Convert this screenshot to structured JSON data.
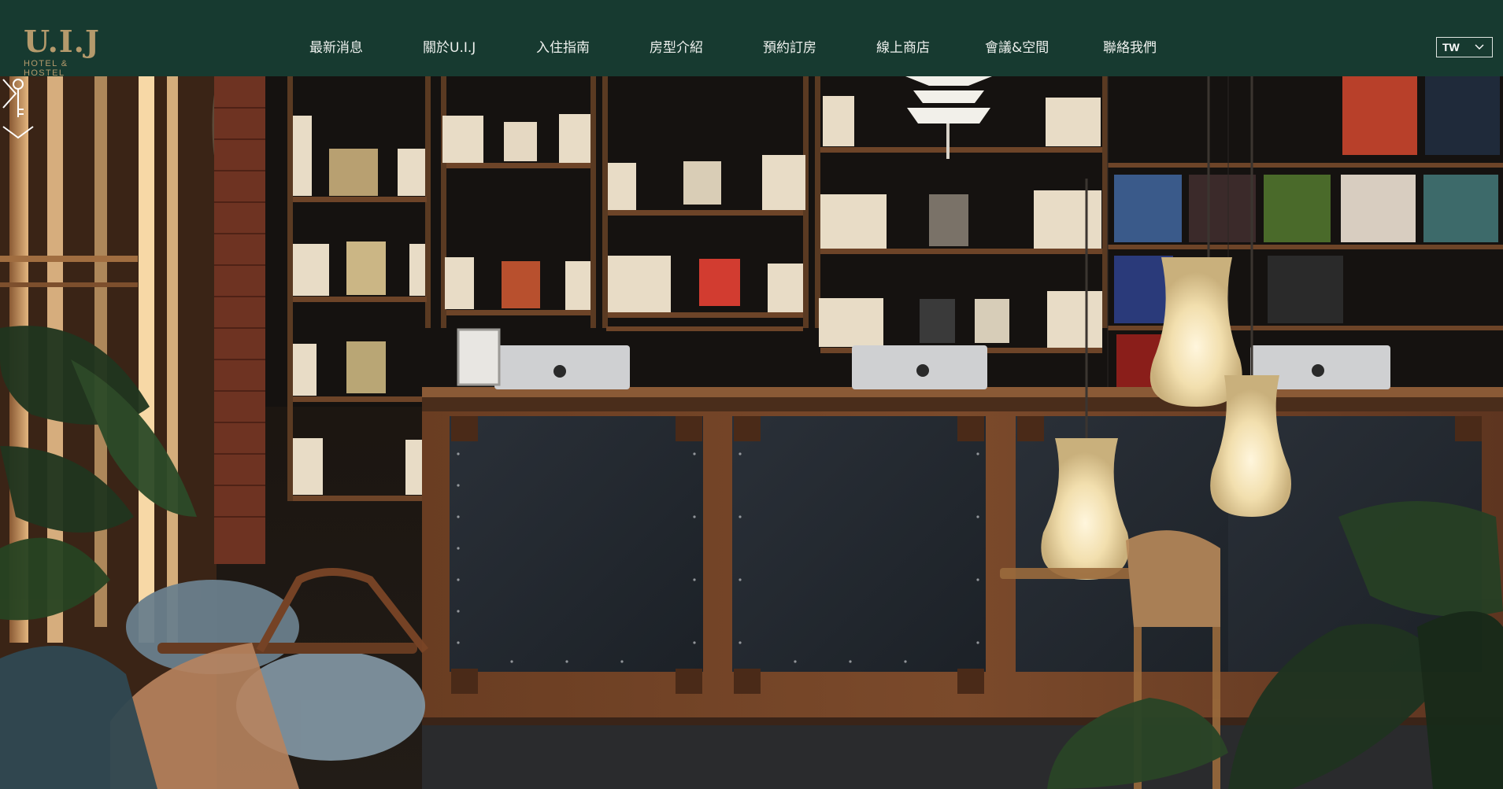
{
  "brand": {
    "logo_text": "U.I.J",
    "logo_subtitle": "HOTEL & HOSTEL"
  },
  "nav": {
    "items": [
      {
        "label": "最新消息"
      },
      {
        "label": "關於U.I.J"
      },
      {
        "label": "入住指南"
      },
      {
        "label": "房型介紹"
      },
      {
        "label": "預約訂房"
      },
      {
        "label": "線上商店"
      },
      {
        "label": "會議&空間"
      },
      {
        "label": "聯絡我們"
      }
    ]
  },
  "language": {
    "selected": "TW"
  },
  "hero": {
    "image_subject": "hotel lobby reception with bookshelves",
    "next_icon": "chevron-right-icon",
    "scroll_icon": "key-scroll-down-icon"
  },
  "colors": {
    "header_bg": "#173a30",
    "logo_gold": "#b59a6c",
    "nav_text": "#eef1ee"
  }
}
